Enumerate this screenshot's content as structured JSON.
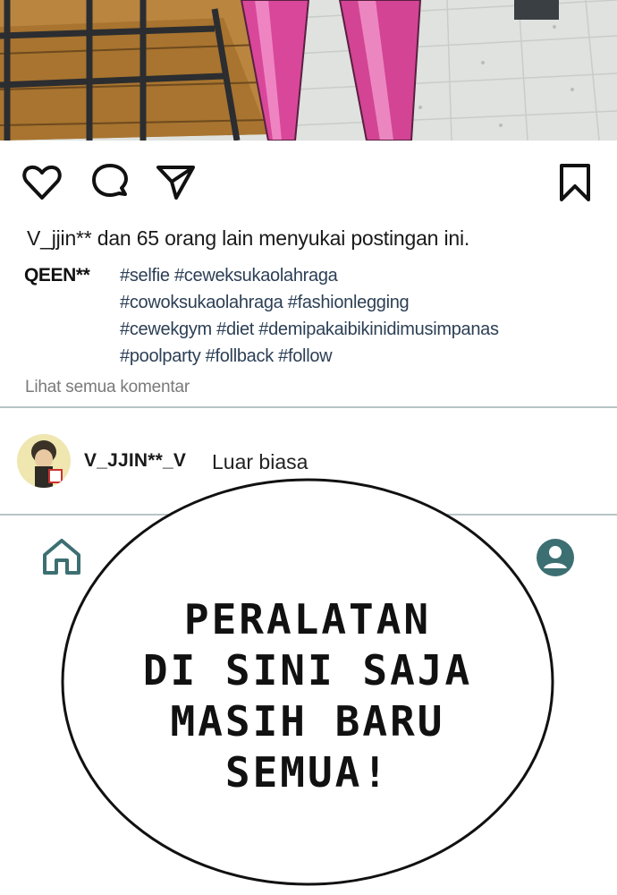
{
  "post": {
    "likes_text": "V_jjin** dan 65 orang lain menyukai postingan ini.",
    "caption_user": "QEEN**",
    "hashtag_lines": [
      "#selfie #ceweksukaolahraga",
      "#cowoksukaolahraga #fashionlegging",
      "#cewekgym #diet #demipakaibikinidimusimpanas",
      "#poolparty #follback #follow"
    ],
    "view_all_comments": "Lihat semua komentar"
  },
  "actions": {
    "like_icon": "heart-icon",
    "comment_icon": "comment-bubble-icon",
    "share_icon": "paper-plane-icon",
    "save_icon": "bookmark-icon"
  },
  "comment": {
    "user": "V_JJIN**_V",
    "text": "Luar biasa"
  },
  "nav": {
    "home_icon": "home-icon",
    "profile_icon": "profile-icon",
    "accent": "#3c6f72"
  },
  "speech_bubble": {
    "lines": [
      "PERALATAN",
      "DI SINI SAJA",
      "MASIH BARU",
      "SEMUA!"
    ]
  }
}
